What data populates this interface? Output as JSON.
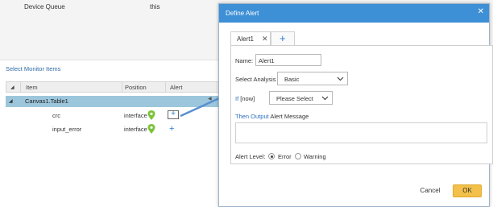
{
  "background": {
    "top_label_1": "Device Queue",
    "top_label_2": "this",
    "section_title": "Select Monitor Items",
    "grid": {
      "headers": [
        "Item",
        "Position",
        "Alert"
      ],
      "group": "Canvas1.Table1",
      "rows": [
        {
          "name": "crc",
          "position": "interface",
          "alert": "+"
        },
        {
          "name": "input_error",
          "position": "interface",
          "alert": "+"
        }
      ]
    }
  },
  "dialog": {
    "title": "Define Alert",
    "tabs": [
      {
        "label": "Alert1"
      }
    ],
    "add_tab_icon": "+",
    "name_label": "Name:",
    "name_value": "Alert1",
    "analysis_label": "Select Analysis",
    "analysis_value": "Basic",
    "if_keyword": "If",
    "if_now": "[now]",
    "if_value": "Please Select",
    "then_output": "Then Output",
    "alert_message_label": "Alert Message",
    "alert_level_label": "Alert Level:",
    "level_options": [
      "Error",
      "Warning"
    ],
    "selected_level": "Error",
    "cancel_label": "Cancel",
    "ok_label": "OK"
  },
  "colors": {
    "header_blue": "#3d8fd6",
    "group_row": "#9cc6dc",
    "ok_button": "#f3c04b",
    "link_blue": "#2d6fc0",
    "pin_green": "#7cc33a"
  },
  "icons": {
    "close": "close-icon",
    "tab_close": "close-icon",
    "add_tab": "plus-icon",
    "chevron": "chevron-down-icon",
    "pin": "map-pin-icon"
  }
}
